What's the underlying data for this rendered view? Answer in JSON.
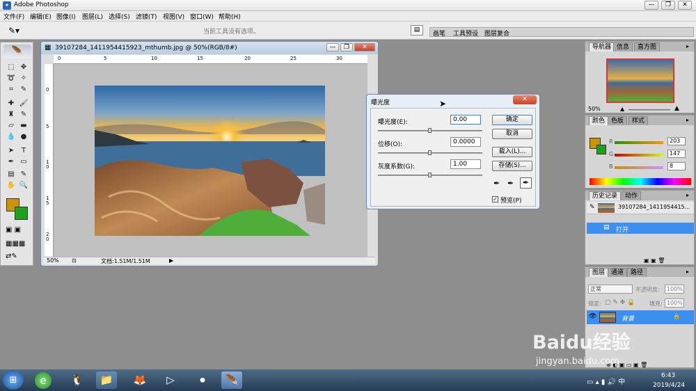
{
  "app": {
    "title": "Adobe Photoshop"
  },
  "window_controls": {
    "minimize": "—",
    "maximize": "❐",
    "close": "✕"
  },
  "menu": [
    "文件(F)",
    "编辑(E)",
    "图像(I)",
    "图层(L)",
    "选择(S)",
    "滤镜(T)",
    "视图(V)",
    "窗口(W)",
    "帮助(H)"
  ],
  "options_bar": {
    "hint": "当前工具没有选项。",
    "tabs": [
      "画笔",
      "工具预设",
      "图层复合"
    ]
  },
  "document": {
    "title": "39107284_1411954415923_mthumb.jpg @ 50%(RGB/8#)",
    "zoom": "50%",
    "status": "文档:1.51M/1.51M",
    "ruler_h": [
      "0",
      "5",
      "10",
      "15",
      "20",
      "25",
      "30"
    ],
    "ruler_v": [
      "0",
      "5",
      "1 0",
      "1 5",
      "2 0"
    ],
    "colors": {
      "sky": "#4a7fb5",
      "sun": "#f2b632",
      "sea": "#2a4f73",
      "rock": "#a0643a",
      "grass": "#4fae3a"
    }
  },
  "dialog": {
    "title": "曝光度",
    "fields": [
      {
        "label": "曝光度(E):",
        "value": "0.00",
        "slider": 0.5
      },
      {
        "label": "位移(O):",
        "value": "0.0000",
        "slider": 0.5
      },
      {
        "label": "灰度系数(G):",
        "value": "1.00",
        "slider": 0.5
      }
    ],
    "buttons": [
      "确定",
      "取消",
      "载入(L)...",
      "存储(S)..."
    ],
    "preview_label": "预览(P)",
    "preview_checked": true
  },
  "navigator": {
    "tabs": [
      "导航器",
      "信息",
      "直方图"
    ],
    "zoom": "50%"
  },
  "color_panel": {
    "tabs": [
      "颜色",
      "色板",
      "样式"
    ],
    "channels": [
      {
        "label": "R",
        "value": "203"
      },
      {
        "label": "G",
        "value": "147"
      },
      {
        "label": "B",
        "value": "8"
      }
    ],
    "fg": "#cb9308",
    "bg": "#1fa01f"
  },
  "history_panel": {
    "tabs": [
      "历史记录",
      "动作"
    ],
    "snapshot": "39107284_1411954415...",
    "step": "打开"
  },
  "layers_panel": {
    "tabs": [
      "图层",
      "通道",
      "路径"
    ],
    "blend_mode": "正常",
    "opacity_label": "不透明度:",
    "opacity": "100%",
    "lock_label": "锁定:",
    "fill_label": "填充:",
    "fill": "100%",
    "layer_name": "背景"
  },
  "watermark": {
    "text": "Baidu经验",
    "url": "jingyan.baidu.com"
  },
  "taskbar": {
    "time": "6:43",
    "date": "2019/4/24"
  }
}
